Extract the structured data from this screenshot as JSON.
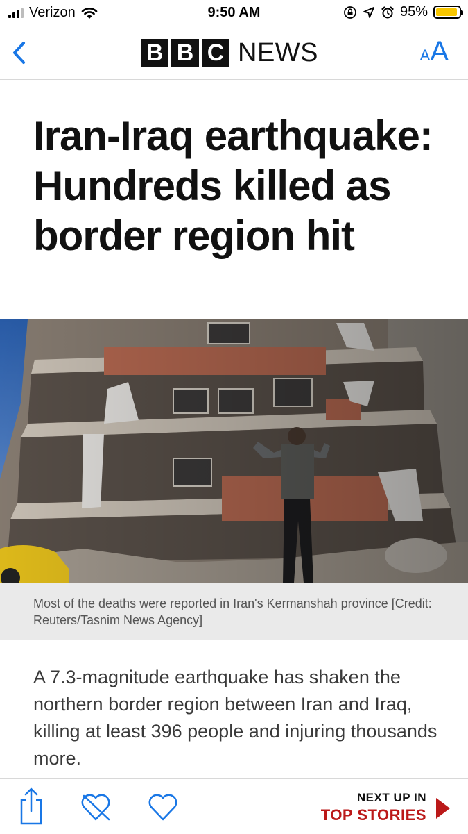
{
  "status_bar": {
    "carrier": "Verizon",
    "time": "9:50 AM",
    "battery_percent_label": "95%",
    "battery_level": 0.95,
    "icons": [
      "signal-bars-icon",
      "wifi-icon",
      "orientation-lock-icon",
      "location-icon",
      "alarm-icon",
      "battery-icon"
    ]
  },
  "nav": {
    "back_icon": "chevron-left-icon",
    "logo_letters": [
      "B",
      "B",
      "C"
    ],
    "logo_word": "NEWS",
    "font_size_small": "A",
    "font_size_large": "A",
    "accent_color": "#1977e6"
  },
  "article": {
    "headline": "Iran-Iraq earthquake: Hundreds killed as border region hit",
    "image_caption": "Most of the deaths were reported in Iran's Kermanshah province [Credit: Reuters/Tasnim News Agency]",
    "body": "A 7.3-magnitude earthquake has shaken the northern border region between Iran and Iraq, killing at least 396 people and injuring thousands more."
  },
  "toolbar": {
    "icons": [
      "share-icon",
      "unlike-heart-icon",
      "like-heart-icon"
    ],
    "next_label": "NEXT UP IN",
    "next_section": "TOP STORIES",
    "brand_red": "#bb1919"
  }
}
